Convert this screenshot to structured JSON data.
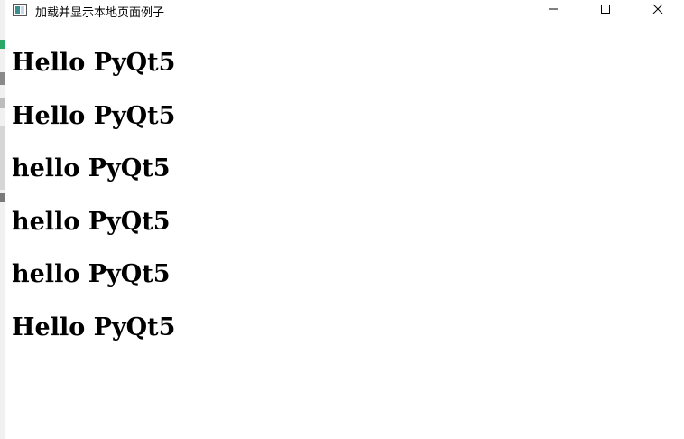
{
  "window": {
    "title": "加载并显示本地页面例子",
    "app_icon": "window-app-icon",
    "controls": {
      "minimize_icon": "minimize-icon",
      "maximize_icon": "maximize-icon",
      "close_icon": "close-icon"
    }
  },
  "content": {
    "lines": [
      "Hello PyQt5",
      "Hello PyQt5",
      "hello PyQt5",
      "hello PyQt5",
      "hello PyQt5",
      "Hello PyQt5"
    ]
  }
}
